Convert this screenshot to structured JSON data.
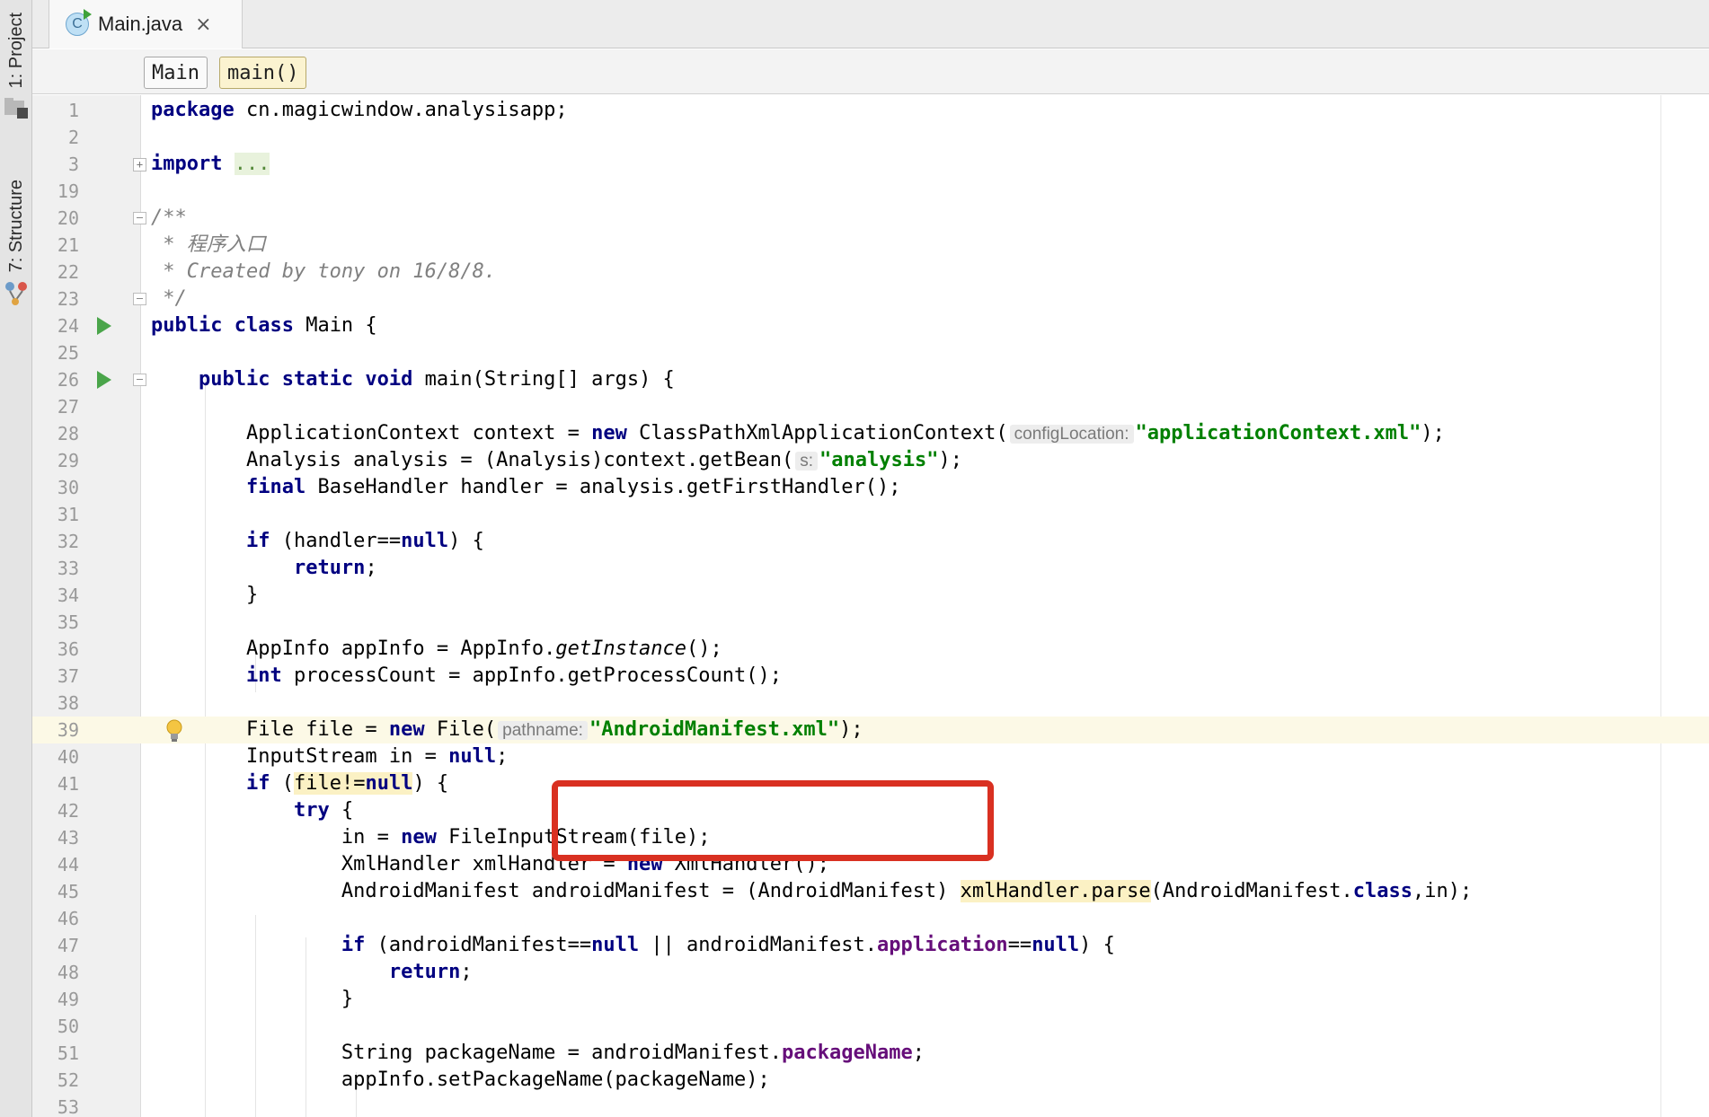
{
  "colors": {
    "keyword": "#000080",
    "string": "#008000",
    "comment": "#808080",
    "field": "#660e7a",
    "current_line": "#fcf9e6",
    "callout": "#d93021"
  },
  "tool_window": {
    "project_label": "1: Project",
    "structure_label": "7: Structure",
    "project_icon": "folder-icon",
    "structure_icon": "structure-icon"
  },
  "tab": {
    "icon": "java-class-icon",
    "icon_letter": "C",
    "label": "Main.java",
    "close": "×"
  },
  "breadcrumb": {
    "class_name": "Main",
    "method_name": "main()"
  },
  "editor": {
    "lines": [
      {
        "n": "1"
      },
      {
        "n": "2"
      },
      {
        "n": "3"
      },
      {
        "n": "19"
      },
      {
        "n": "20"
      },
      {
        "n": "21"
      },
      {
        "n": "22"
      },
      {
        "n": "23"
      },
      {
        "n": "24"
      },
      {
        "n": "25"
      },
      {
        "n": "26"
      },
      {
        "n": "27"
      },
      {
        "n": "28"
      },
      {
        "n": "29"
      },
      {
        "n": "30"
      },
      {
        "n": "31"
      },
      {
        "n": "32"
      },
      {
        "n": "33"
      },
      {
        "n": "34"
      },
      {
        "n": "35"
      },
      {
        "n": "36"
      },
      {
        "n": "37"
      },
      {
        "n": "38"
      },
      {
        "n": "39"
      },
      {
        "n": "40"
      },
      {
        "n": "41"
      },
      {
        "n": "42"
      },
      {
        "n": "43"
      },
      {
        "n": "44"
      },
      {
        "n": "45"
      },
      {
        "n": "46"
      },
      {
        "n": "47"
      },
      {
        "n": "48"
      },
      {
        "n": "49"
      },
      {
        "n": "50"
      },
      {
        "n": "51"
      },
      {
        "n": "52"
      },
      {
        "n": "53"
      }
    ],
    "code": {
      "l1": {
        "kw": "package",
        "rest": " cn.magicwindow.analysisapp;"
      },
      "l3": {
        "kw": "import",
        "folded": "..."
      },
      "l20": "/**",
      "l21": " * 程序入口",
      "l22": " * Created by tony on 16/8/8.",
      "l23": " */",
      "l24": {
        "kw": "public class",
        "rest": " Main {"
      },
      "l26": {
        "kw": "public static void",
        "rest": " main(String[] args) {"
      },
      "l28": {
        "a": "ApplicationContext context = ",
        "kw": "new",
        "b": " ClassPathXmlApplicationContext(",
        "hint": "configLocation:",
        "str": "\"applicationContext.xml\"",
        "c": ");"
      },
      "l29": {
        "a": "Analysis analysis = (Analysis)context.getBean(",
        "hint": "s:",
        "str": "\"analysis\"",
        "c": ");"
      },
      "l30": {
        "kw": "final",
        "rest": " BaseHandler handler = analysis.getFirstHandler();"
      },
      "l32": {
        "kw": "if",
        "a": " (handler==",
        "kw2": "null",
        "b": ") {"
      },
      "l33": {
        "kw": "return",
        "rest": ";"
      },
      "l34": "}",
      "l36": {
        "a": "AppInfo appInfo = AppInfo.",
        "ital": "getInstance",
        "b": "();"
      },
      "l37": {
        "kw": "int",
        "rest": " processCount = appInfo.getProcessCount();"
      },
      "l39": {
        "a": "File file = ",
        "kw": "new",
        "b": " File(",
        "hint": "pathname:",
        "str": "\"AndroidManifest.xml\"",
        "c": ");"
      },
      "l40": {
        "a": "InputStream in = ",
        "kw": "null",
        "b": ";"
      },
      "l41": {
        "kw": "if",
        "a": " (",
        "hl": "file!=",
        "kw2": "null",
        "b": ") {"
      },
      "l42": {
        "kw": "try",
        "rest": " {"
      },
      "l43": {
        "a": "in = ",
        "kw": "new",
        "b": " FileInputStream(file);"
      },
      "l44": {
        "a": "XmlHandler xmlHandler = ",
        "kw": "new",
        "b": " XmlHandler();"
      },
      "l45": {
        "a": "AndroidManifest androidManifest = (AndroidManifest) ",
        "hl": "xmlHandler.parse",
        "b": "(AndroidManifest.",
        "kw": "class",
        "c": ",in);"
      },
      "l47": {
        "kw": "if",
        "a": " (androidManifest==",
        "kw2": "null",
        "b": " || androidManifest.",
        "fld": "application",
        "c": "==",
        "kw3": "null",
        "d": ") {"
      },
      "l48": {
        "kw": "return",
        "rest": ";"
      },
      "l49": "}",
      "l51": {
        "a": "String packageName = androidManifest.",
        "fld": "packageName",
        "b": ";"
      },
      "l52": "appInfo.setPackageName(packageName);"
    },
    "gutter_icons": {
      "run": "run-icon",
      "bulb": "lightbulb-icon",
      "fold": "fold-icon",
      "fold_plus": "+"
    }
  }
}
